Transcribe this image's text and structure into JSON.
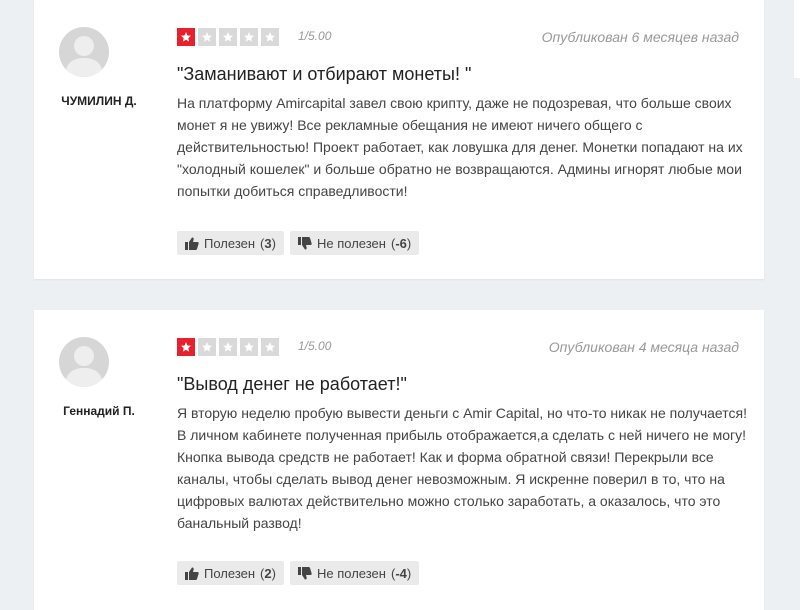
{
  "reviews": [
    {
      "author": "ЧУМИЛИН Д.",
      "rating": 1,
      "max_rating": 5,
      "score_text": "1/5.00",
      "published": "Опубликован 6 месяцев назад",
      "title": "\"Заманивают и отбирают монеты! \"",
      "text": "На платформу Amircapital завел свою крипту, даже не подозревая, что больше своих монет я не увижу! Все рекламные обещания не имеют ничего общего с действительностью! Проект работает, как ловушка для денег. Монетки попадают на их \"холодный кошелек\" и больше обратно не возвращаются. Админы игнорят любые мои попытки добиться справедливости!",
      "helpful_label": "Полезен",
      "helpful_count": "3",
      "unhelpful_label": "Не полезен",
      "unhelpful_count": "-6"
    },
    {
      "author": "Геннадий П.",
      "rating": 1,
      "max_rating": 5,
      "score_text": "1/5.00",
      "published": "Опубликован 4 месяца назад",
      "title": "\"Вывод денег не работает!\"",
      "text": "Я вторую неделю пробую вывести деньги с Amir Capital, но что-то никак не получается! В личном кабинете полученная прибыль отображается,а сделать с ней ничего не могу! Кнопка вывода средств не работает! Как и форма обратной связи! Перекрыли все каналы, чтобы сделать вывод денег невозможным. Я искренне поверил в то, что на цифровых валютах действительно можно столько заработать, а оказалось, что это банальный развод!",
      "helpful_label": "Полезен",
      "helpful_count": "2",
      "unhelpful_label": "Не полезен",
      "unhelpful_count": "-4"
    }
  ],
  "icons": {
    "star": "star-icon",
    "avatar": "user-avatar-icon",
    "thumbs_up": "thumbs-up-icon",
    "thumbs_down": "thumbs-down-icon"
  },
  "colors": {
    "star_filled": "#e8202c",
    "star_empty": "#d9d9d9"
  }
}
